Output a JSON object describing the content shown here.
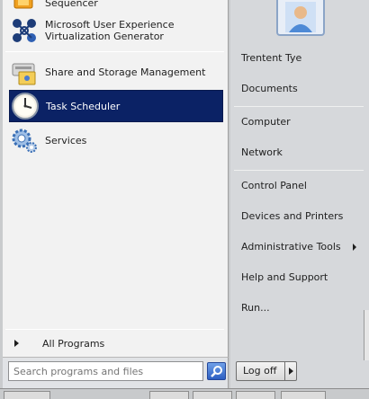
{
  "left_pane": {
    "programs": [
      {
        "label": "Sequencer",
        "icon": "sequencer-icon"
      },
      {
        "label": "Microsoft User Experience\nVirtualization Generator",
        "icon": "uev-generator-icon"
      },
      {
        "label": "Share and Storage Management",
        "icon": "share-storage-icon"
      },
      {
        "label": "Task Scheduler",
        "icon": "task-scheduler-icon",
        "selected": true
      },
      {
        "label": "Services",
        "icon": "services-gear-icon"
      }
    ],
    "all_programs": "All Programs"
  },
  "search": {
    "placeholder": "Search programs and files"
  },
  "right_pane": {
    "items": [
      {
        "label": "Trentent Tye"
      },
      {
        "label": "Documents"
      },
      {
        "label": "Computer"
      },
      {
        "label": "Network"
      },
      {
        "label": "Control Panel"
      },
      {
        "label": "Devices and Printers"
      },
      {
        "label": "Administrative Tools",
        "submenu": true
      },
      {
        "label": "Help and Support"
      },
      {
        "label": "Run..."
      }
    ],
    "logoff": "Log off"
  },
  "colors": {
    "selection": "#0b2265",
    "pane_left": "#f2f2f2",
    "pane_right": "#d6d8db"
  }
}
